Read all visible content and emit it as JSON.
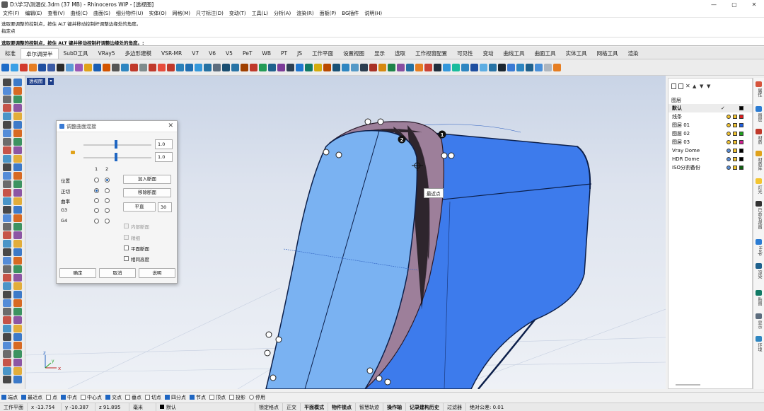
{
  "window": {
    "title": "D:\\学习\\测温仪.3dm (37 MB) - Rhinoceros WIP - [透视图]"
  },
  "menu": [
    "文件(F)",
    "编辑(E)",
    "查看(V)",
    "曲线(C)",
    "曲面(S)",
    "细分物件(U)",
    "实体(O)",
    "网格(M)",
    "尺寸标注(D)",
    "变动(T)",
    "工具(L)",
    "分析(A)",
    "渲染(R)",
    "面板(P)",
    "BG插件",
    "说明(H)"
  ],
  "command": {
    "history": [
      "选取要调整的控制点，按住 ALT 键并移动控制杆调整边缘处的角度。",
      "指定点"
    ],
    "prompt": "选取要调整的控制点，按住 ALT 键并移动控制杆调整边缘处的角度。:"
  },
  "tabs": [
    "标准",
    "卓尔调屏半",
    "SubD工具",
    "VRay5",
    "多边形建模",
    "VSR-MR",
    "V7",
    "V6",
    "V5",
    "PeT",
    "WB",
    "PT",
    "JS",
    "工作平面",
    "设置视图",
    "显示",
    "选取",
    "工作视窗配置",
    "可见性",
    "变动",
    "曲线工具",
    "曲面工具",
    "实体工具",
    "网格工具",
    "渲染"
  ],
  "viewport": {
    "name": "透视图",
    "arrow": "▾",
    "near_point": "最近点",
    "marker1": "1",
    "marker2": "2"
  },
  "axis": {
    "x": "x",
    "y": "y",
    "z": "z"
  },
  "dialog": {
    "title": "调整曲面混接",
    "value1": "1.0",
    "value2": "1.0",
    "col1": "1",
    "col2": "2",
    "rows": [
      "位置",
      "正切",
      "曲率",
      "G3",
      "G4"
    ],
    "btn_add": "加入断面",
    "btn_remove": "移除断面",
    "btn_flat": "平直",
    "flat_value": "30",
    "opt_inner": "内部断面",
    "opt_thin": "精细",
    "opt_plane": "平面断面",
    "opt_same": "相同高度",
    "ok": "确定",
    "cancel": "取消",
    "help": "说明"
  },
  "layers": {
    "title": "图层",
    "items": [
      {
        "name": "默认",
        "color": "#000000"
      },
      {
        "name": "线条",
        "color": "#e02020"
      },
      {
        "name": "图层 01",
        "color": "#2060e0"
      },
      {
        "name": "图层 02",
        "color": "#20a020"
      },
      {
        "name": "图层 03",
        "color": "#d02090"
      },
      {
        "name": "Vray Dome",
        "color": "#000000"
      },
      {
        "name": "HDR Dome",
        "color": "#000000"
      },
      {
        "name": "ISO分割备份",
        "color": "#106010"
      }
    ],
    "check": "✓"
  },
  "side_tabs": [
    "属性",
    "图层",
    "材质",
    "材质库",
    "灯光",
    "已命名视图",
    "Help",
    "渲染",
    "贴图",
    "显示",
    "环境"
  ],
  "osnap": [
    {
      "label": "端点",
      "on": true
    },
    {
      "label": "最近点",
      "on": true
    },
    {
      "label": "点",
      "on": false
    },
    {
      "label": "中点",
      "on": true
    },
    {
      "label": "中心点",
      "on": false
    },
    {
      "label": "交点",
      "on": true
    },
    {
      "label": "垂点",
      "on": false
    },
    {
      "label": "切点",
      "on": false
    },
    {
      "label": "四分点",
      "on": true
    },
    {
      "label": "节点",
      "on": true
    },
    {
      "label": "顶点",
      "on": false
    },
    {
      "label": "投影",
      "on": false
    },
    {
      "label": "停用",
      "on": false
    }
  ],
  "status": {
    "plane": "工作平面",
    "x": "x -13.754",
    "y": "y -10.387",
    "z": "z 91.895",
    "unit": "毫米",
    "layer": "默认",
    "lock": "锁定格点",
    "ortho": "正交",
    "planar": "平面模式",
    "osnap": "物件锁点",
    "smarttrack": "智慧轨迹",
    "gumball": "操作轴",
    "history": "记录建构历史",
    "filter": "过滤器",
    "tolerance": "绝对公差: 0.01"
  },
  "colors": {
    "accent": "#1e3f8a",
    "surface_light": "#7ab2f2",
    "surface_dark": "#3f7eea",
    "blend": "#9c7f99"
  }
}
